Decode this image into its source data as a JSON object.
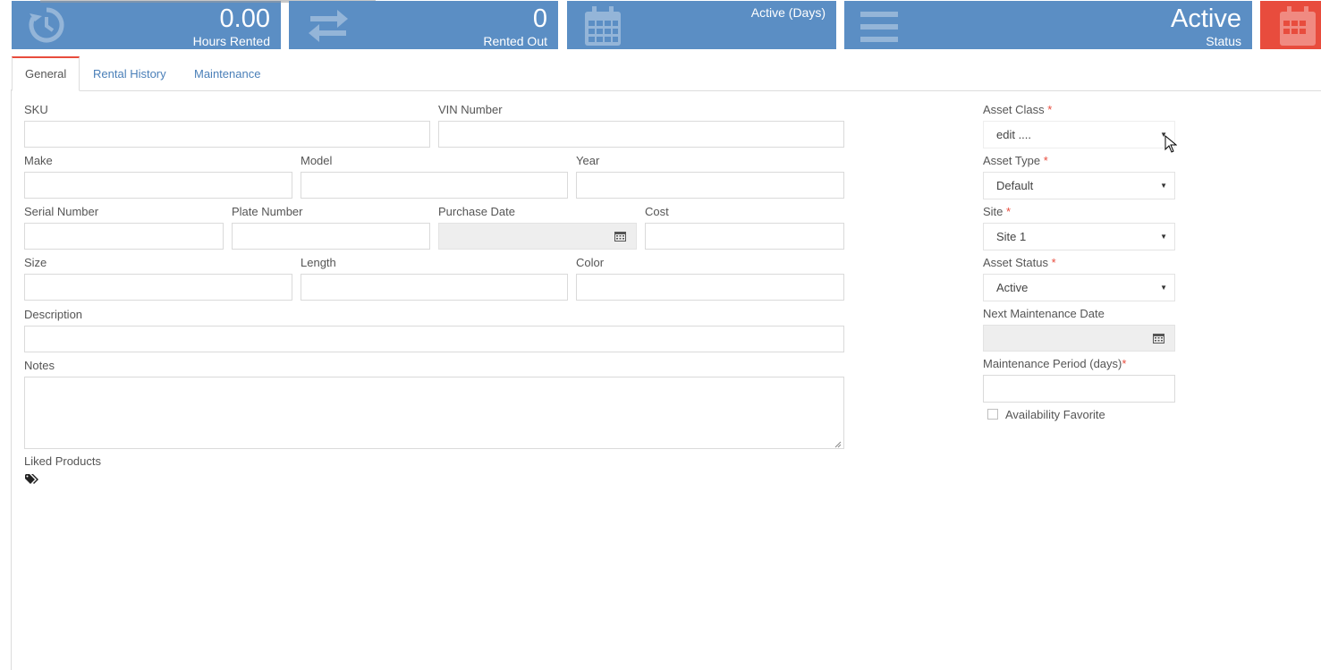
{
  "stats": {
    "hours_rented": {
      "value": "0.00",
      "label": "Hours Rented",
      "icon": "history-icon"
    },
    "rented_out": {
      "value": "0",
      "label": "Rented Out",
      "icon": "transfer-icon"
    },
    "active_days": {
      "label": "Active (Days)",
      "icon": "calendar-icon"
    },
    "status": {
      "value": "Active",
      "label": "Status",
      "icon": "list-icon"
    },
    "extra": {
      "icon": "calendar-icon"
    }
  },
  "colors": {
    "tile_blue": "#5b8ec4",
    "tile_red": "#e84c3d",
    "link": "#4a7fb8",
    "required": "#e84c3d"
  },
  "tabs": [
    {
      "label": "General",
      "active": true
    },
    {
      "label": "Rental History",
      "active": false
    },
    {
      "label": "Maintenance",
      "active": false
    }
  ],
  "form": {
    "sku": {
      "label": "SKU",
      "value": ""
    },
    "vin": {
      "label": "VIN Number",
      "value": ""
    },
    "make": {
      "label": "Make",
      "value": ""
    },
    "model": {
      "label": "Model",
      "value": ""
    },
    "year": {
      "label": "Year",
      "value": ""
    },
    "serial": {
      "label": "Serial Number",
      "value": ""
    },
    "plate": {
      "label": "Plate Number",
      "value": ""
    },
    "purchase_date": {
      "label": "Purchase Date",
      "value": ""
    },
    "cost": {
      "label": "Cost",
      "value": ""
    },
    "size": {
      "label": "Size",
      "value": ""
    },
    "length": {
      "label": "Length",
      "value": ""
    },
    "color": {
      "label": "Color",
      "value": ""
    },
    "description": {
      "label": "Description",
      "value": ""
    },
    "notes": {
      "label": "Notes",
      "value": ""
    },
    "liked_products": {
      "label": "Liked Products",
      "icon": "tags-icon"
    }
  },
  "sidebar": {
    "asset_class": {
      "label": "Asset Class",
      "value": "edit ...."
    },
    "asset_type": {
      "label": "Asset Type",
      "value": "Default"
    },
    "site": {
      "label": "Site",
      "value": "Site 1"
    },
    "asset_status": {
      "label": "Asset Status",
      "value": "Active"
    },
    "next_maintenance_date": {
      "label": "Next Maintenance Date",
      "value": ""
    },
    "maintenance_period": {
      "label": "Maintenance Period (days)",
      "value": ""
    },
    "availability_favorite": {
      "label": "Availability Favorite",
      "checked": false
    },
    "required_marker": "*"
  }
}
